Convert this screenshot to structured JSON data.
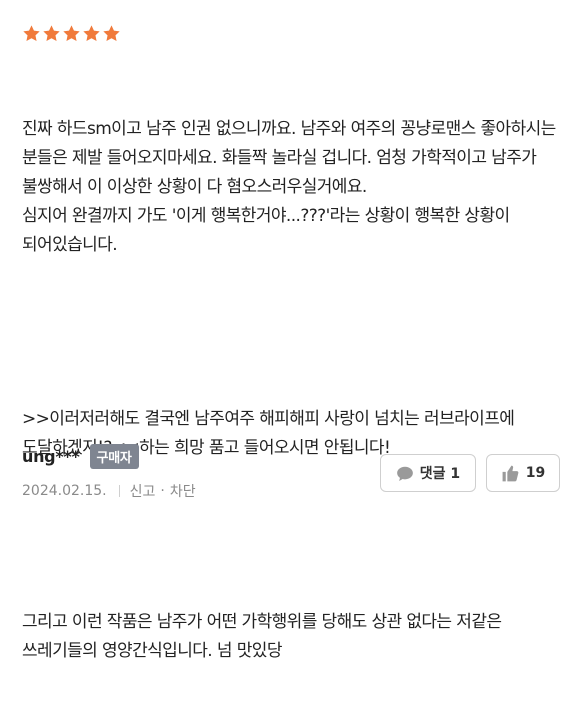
{
  "review": {
    "rating": 5,
    "rating_max": 5,
    "star_color": "#f07a3b",
    "paragraphs": [
      "진짜 하드sm이고 남주 인권 없으니까요. 남주와 여주의 꽁냥로맨스 좋아하시는 분들은 제발 들어오지마세요. 화들짝 놀라실 겁니다. 엄청 가학적이고 남주가 불쌍해서 이 이상한 상황이 다 혐오스러우실거에요.\n심지어 완결까지 가도 '이게 행복한거야...???'라는 상황이 행복한 상황이 되어있습니다.",
      ">>이러저러해도 결국엔 남주여주 해피해피 사랑이 넘치는 러브라이프에 도달하겠지!?<<하는 희망 품고 들어오시면 안됩니다!",
      "그리고 이런 작품은 남주가 어떤 가학행위를 당해도 상관 없다는 저같은 쓰레기들의 영양간식입니다. 넘 맛있당"
    ],
    "author": "ung***",
    "badge": "구매자",
    "date": "2024.02.15.",
    "report_label": "신고",
    "dot": "·",
    "block_label": "차단",
    "comment_label": "댓글 1",
    "like_count": "19",
    "badge_color": "#7f8591"
  }
}
